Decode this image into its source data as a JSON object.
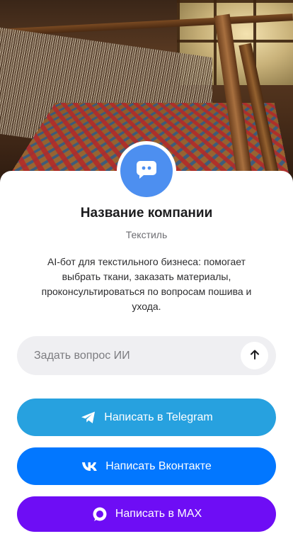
{
  "company": {
    "name": "Название компании",
    "category": "Текстиль",
    "description": "AI-бот для текстильного бизнеса: помогает выбрать ткани, заказать материалы, проконсультироваться по вопросам пошива и ухода."
  },
  "ask": {
    "placeholder": "Задать вопрос ИИ",
    "send_icon": "arrow-up-icon"
  },
  "buttons": {
    "telegram": {
      "label": "Написать в Telegram",
      "icon": "telegram-icon",
      "color": "#27a1df"
    },
    "vk": {
      "label": "Написать Вконтакте",
      "icon": "vk-icon",
      "color": "#0277ff"
    },
    "max": {
      "label": "Написать в MAX",
      "icon": "max-icon",
      "color": "#6e0df5"
    }
  },
  "colors": {
    "avatar": "#4d8ff0",
    "input_bg": "#efeff2"
  },
  "hero": {
    "image": "weaving-loom-photo"
  },
  "avatar": {
    "icon": "chat-bot-icon"
  }
}
